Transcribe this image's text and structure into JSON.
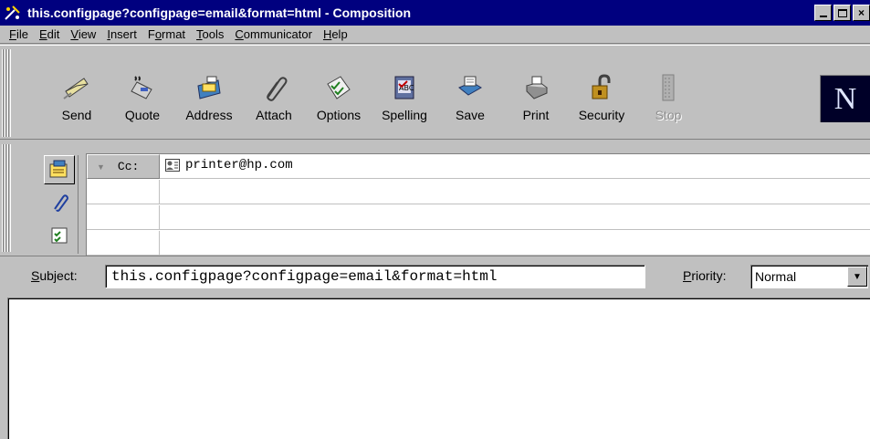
{
  "window": {
    "title": "this.configpage?configpage=email&format=html - Composition",
    "icons": [
      "composer-app-icon",
      "minimize-icon",
      "maximize-icon",
      "close-icon"
    ]
  },
  "menu": [
    {
      "accel": "F",
      "rest": "ile"
    },
    {
      "accel": "E",
      "rest": "dit"
    },
    {
      "accel": "V",
      "rest": "iew"
    },
    {
      "accel": "I",
      "rest": "nsert"
    },
    {
      "pre": "F",
      "accel": "o",
      "rest": "rmat"
    },
    {
      "accel": "T",
      "rest": "ools"
    },
    {
      "accel": "C",
      "rest": "ommunicator"
    },
    {
      "accel": "H",
      "rest": "elp"
    }
  ],
  "toolbar": {
    "send": "Send",
    "quote": "Quote",
    "address": "Address",
    "attach": "Attach",
    "options": "Options",
    "spelling": "Spelling",
    "save": "Save",
    "print": "Print",
    "security": "Security",
    "stop": "Stop",
    "logo": "N"
  },
  "addressing": {
    "rows": [
      {
        "type": "Cc:",
        "value": "printer@hp.com"
      },
      {
        "type": "",
        "value": ""
      },
      {
        "type": "",
        "value": ""
      },
      {
        "type": "",
        "value": ""
      }
    ]
  },
  "subject": {
    "label_accel": "S",
    "label_rest": "ubject:",
    "value": "this.configpage?configpage=email&format=html"
  },
  "priority": {
    "label_accel": "P",
    "label_rest": "riority:",
    "value": "Normal"
  },
  "colors": {
    "titlebar": "#00007f",
    "face": "#c0c0c0"
  }
}
